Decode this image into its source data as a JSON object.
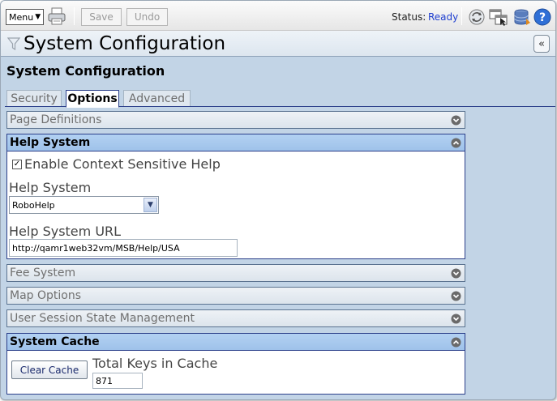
{
  "toolbar": {
    "menu_label": "Menu",
    "save_label": "Save",
    "undo_label": "Undo",
    "status_label": "Status:",
    "status_value": "Ready",
    "icons": [
      "printer-icon",
      "refresh-icon",
      "window-pointer-icon",
      "database-icon",
      "help-icon"
    ]
  },
  "titlebar": {
    "title": "System Configuration",
    "collapse_glyph": "«"
  },
  "section_title": "System Configuration",
  "tabs": [
    {
      "label": "Security",
      "active": false
    },
    {
      "label": "Options",
      "active": true
    },
    {
      "label": "Advanced",
      "active": false
    }
  ],
  "panels": {
    "page_definitions": {
      "label": "Page Definitions",
      "expanded": false
    },
    "help_system": {
      "label": "Help System",
      "expanded": true,
      "enable_context_help_label": "Enable Context Sensitive Help",
      "enable_context_help_checked": true,
      "help_system_label": "Help System",
      "help_system_value": "RoboHelp",
      "help_url_label": "Help System URL",
      "help_url_value": "http://qamr1web32vm/MSB/Help/USA"
    },
    "fee_system": {
      "label": "Fee System",
      "expanded": false
    },
    "map_options": {
      "label": "Map Options",
      "expanded": false
    },
    "user_session": {
      "label": "User Session State Management",
      "expanded": false
    },
    "system_cache": {
      "label": "System Cache",
      "expanded": true,
      "clear_button_label": "Clear Cache",
      "total_keys_label": "Total Keys in Cache",
      "total_keys_value": "871"
    }
  },
  "colors": {
    "background": "#c2d4e6",
    "expanded_header": "#a8cbf0",
    "accent_border": "#2b3f8a",
    "status_ready": "#1f3fd0"
  }
}
